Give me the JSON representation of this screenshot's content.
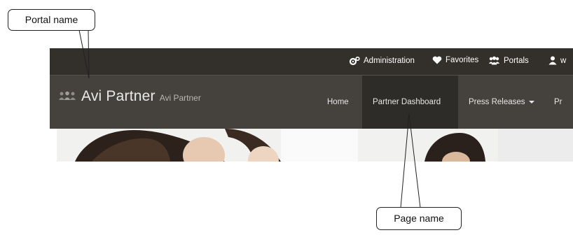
{
  "annotations": {
    "portal_label": "Portal name",
    "page_label": "Page name"
  },
  "topbar": {
    "items": [
      {
        "label": "Administration",
        "icon": "gears-icon"
      },
      {
        "label": "Favorites",
        "icon": "heart-icon"
      },
      {
        "label": "Portals",
        "icon": "users-icon"
      },
      {
        "label": "w",
        "icon": "user-icon"
      }
    ]
  },
  "brand": {
    "name": "Avi Partner",
    "subtitle": "Avi Partner",
    "logo_icon": "people-logo-icon"
  },
  "nav": {
    "items": [
      {
        "label": "Home",
        "active": false
      },
      {
        "label": "Partner Dashboard",
        "active": true
      },
      {
        "label": "Press Releases",
        "active": false,
        "dropdown": true
      },
      {
        "label": "Pr",
        "active": false
      }
    ]
  },
  "colors": {
    "topbar": "#33302b",
    "navbar": "#45423e",
    "active_nav": "#2e2c28",
    "text": "#ffffff"
  }
}
